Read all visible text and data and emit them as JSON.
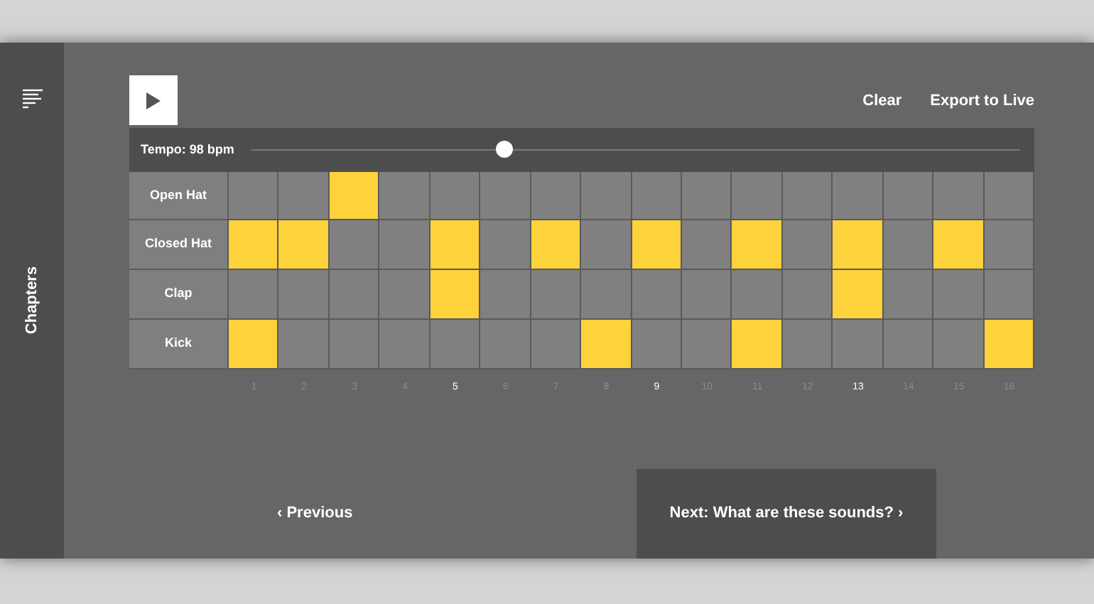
{
  "sidebar": {
    "label": "Chapters"
  },
  "toolbar": {
    "actions": [
      "Clear",
      "Export to Live"
    ]
  },
  "tempo": {
    "label": "Tempo: 98 bpm",
    "level": 0.33
  },
  "tracks": [
    {
      "name": "Open Hat",
      "steps": [
        {
          "on": false
        },
        {
          "on": false
        },
        {
          "on": true
        },
        {
          "on": false
        },
        {
          "on": false
        },
        {
          "on": false
        },
        {
          "on": false
        },
        {
          "on": false
        },
        {
          "on": false
        },
        {
          "on": false
        },
        {
          "on": false
        },
        {
          "on": false
        },
        {
          "on": false
        },
        {
          "on": false
        },
        {
          "on": false
        },
        {
          "on": false
        }
      ]
    },
    {
      "name": "Closed Hat",
      "steps": [
        {
          "on": true
        },
        {
          "on": true
        },
        {
          "on": false
        },
        {
          "on": false
        },
        {
          "on": true
        },
        {
          "on": false
        },
        {
          "on": true
        },
        {
          "on": false
        },
        {
          "on": true
        },
        {
          "on": false
        },
        {
          "on": true
        },
        {
          "on": false
        },
        {
          "on": true
        },
        {
          "on": false
        },
        {
          "on": true
        },
        {
          "on": false
        }
      ]
    },
    {
      "name": "Clap",
      "steps": [
        {
          "on": false
        },
        {
          "on": false
        },
        {
          "on": false
        },
        {
          "on": false
        },
        {
          "on": true
        },
        {
          "on": false
        },
        {
          "on": false
        },
        {
          "on": false
        },
        {
          "on": false
        },
        {
          "on": false
        },
        {
          "on": false
        },
        {
          "on": false
        },
        {
          "on": true
        },
        {
          "on": false
        },
        {
          "on": false
        },
        {
          "on": false
        }
      ]
    },
    {
      "name": "Kick",
      "steps": [
        {
          "on": true
        },
        {
          "on": false
        },
        {
          "on": false
        },
        {
          "on": false
        },
        {
          "on": false
        },
        {
          "on": false
        },
        {
          "on": false
        },
        {
          "on": true
        },
        {
          "on": false
        },
        {
          "on": false
        },
        {
          "on": true
        },
        {
          "on": false
        },
        {
          "on": false
        },
        {
          "on": false
        },
        {
          "on": false
        },
        {
          "on": true
        }
      ]
    }
  ],
  "step_numbers": [
    {
      "label": "1",
      "highlighted": false
    },
    {
      "label": "2",
      "highlighted": false
    },
    {
      "label": "3",
      "highlighted": false
    },
    {
      "label": "4",
      "highlighted": false
    },
    {
      "label": "5",
      "highlighted": true
    },
    {
      "label": "6",
      "highlighted": false
    },
    {
      "label": "7",
      "highlighted": false
    },
    {
      "label": "8",
      "highlighted": false
    },
    {
      "label": "9",
      "highlighted": true
    },
    {
      "label": "10",
      "highlighted": false
    },
    {
      "label": "11",
      "highlighted": false
    },
    {
      "label": "12",
      "highlighted": false
    },
    {
      "label": "13",
      "highlighted": true
    },
    {
      "label": "14",
      "highlighted": false
    },
    {
      "label": "15",
      "highlighted": false
    },
    {
      "label": "16",
      "highlighted": false
    }
  ],
  "navigation": {
    "previous": "‹ Previous",
    "next": "Next: What are these sounds? ›"
  }
}
